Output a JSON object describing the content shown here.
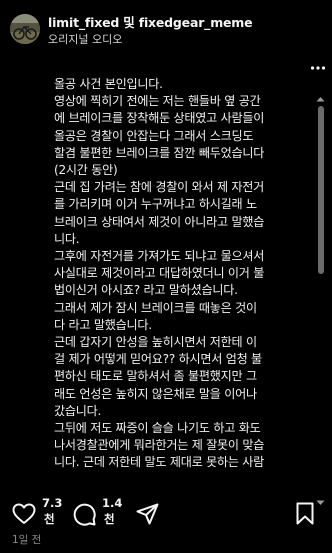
{
  "header": {
    "account_name": "limit_fixed 및 fixedgear_meme",
    "audio_label": "오리지널 오디오"
  },
  "post": {
    "lines": [
      "올공 사건 본인입니다.",
      "영상에 찍히기 전에는 저는 핸들바 옆 공간",
      "에 브레이크를 장착해둔 상태였고 사람들이",
      "올공은 경찰이 안잡는다 그래서 스크딩도",
      "할겸 불편한 브레이크를 잠깐 빼두었습니다",
      "(2시간 동안)",
      "근데 집 가려는 참에 경찰이 와서 제 자전거",
      "를 가리키며 이거 누구꺼냐고 하시길래 노",
      "브레이크 상태여서 제것이 아니라고 말했습",
      "니다.",
      "그후에 자전거를 가져가도 되냐고 물으셔서",
      "사실대로 제것이라고 대답하였더니 이거 불",
      "법이신거 아시죠? 라고 말하셨습니다.",
      "그래서 제가 잠시 브레이크를 때놓은 것이",
      "다 라고 말했습니다.",
      "근데 갑자기 안성을 높히시면서 저한테 이",
      "걸 제가 어떻게 믿어요?? 하시면서 엄청 불",
      "편하신 태도로 말하셔서 좀 불편했지만 그",
      "래도 언성은 높히지 않은채로 말을 이어나",
      "갔습니다.",
      "그뒤에 저도 짜증이 슬슬 나기도 하고 화도",
      "나서경찰관에게 뭐라한거는 제 잘못이 맞습",
      "니다. 근데 저한테 말도 제대로 못하는 사람"
    ]
  },
  "actions": {
    "like_count_line1": "7.3",
    "like_count_line2": "천",
    "comment_count_line1": "1.4",
    "comment_count_line2": "천"
  },
  "meta": {
    "time_ago": "1일 전"
  },
  "icons": {
    "more": "more-horizontal-icon",
    "like": "heart-icon",
    "comment": "comment-bubble-icon",
    "repost": "repost-icon",
    "share": "send-icon",
    "save": "bookmark-icon"
  }
}
